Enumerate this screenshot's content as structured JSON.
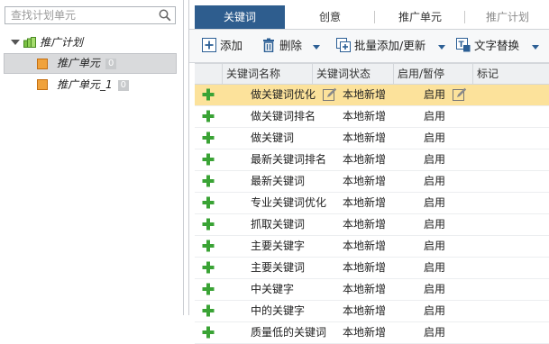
{
  "search": {
    "placeholder": "查找计划单元"
  },
  "tree": {
    "root_label": "推广计划",
    "units": [
      {
        "label": "推广单元",
        "count": "0",
        "selected": true
      },
      {
        "label": "推广单元_1",
        "count": "0",
        "selected": false
      }
    ]
  },
  "tabs": [
    "关键词",
    "创意",
    "推广单元",
    "推广计划"
  ],
  "toolbar": {
    "add": "添加",
    "delete": "删除",
    "bulk_add": "批量添加/更新",
    "replace": "文字替换"
  },
  "table": {
    "headers": [
      "关键词名称",
      "关键词状态",
      "启用/暂停",
      "标记"
    ],
    "rows": [
      {
        "name": "做关键词优化",
        "status": "本地新增",
        "enabled": "启用"
      },
      {
        "name": "做关键词排名",
        "status": "本地新增",
        "enabled": "启用"
      },
      {
        "name": "做关键词",
        "status": "本地新增",
        "enabled": "启用"
      },
      {
        "name": "最新关键词排名",
        "status": "本地新增",
        "enabled": "启用"
      },
      {
        "name": "最新关键词",
        "status": "本地新增",
        "enabled": "启用"
      },
      {
        "name": "专业关键词优化",
        "status": "本地新增",
        "enabled": "启用"
      },
      {
        "name": "抓取关键词",
        "status": "本地新增",
        "enabled": "启用"
      },
      {
        "name": "主要关键字",
        "status": "本地新增",
        "enabled": "启用"
      },
      {
        "name": "主要关键词",
        "status": "本地新增",
        "enabled": "启用"
      },
      {
        "name": "中关键字",
        "status": "本地新增",
        "enabled": "启用"
      },
      {
        "name": "中的关键字",
        "status": "本地新增",
        "enabled": "启用"
      },
      {
        "name": "质量低的关键词",
        "status": "本地新增",
        "enabled": "启用"
      }
    ]
  },
  "colors": {
    "accent": "#2e5d8e",
    "highlight_row": "#fce29b",
    "plus_green": "#3aa335"
  }
}
